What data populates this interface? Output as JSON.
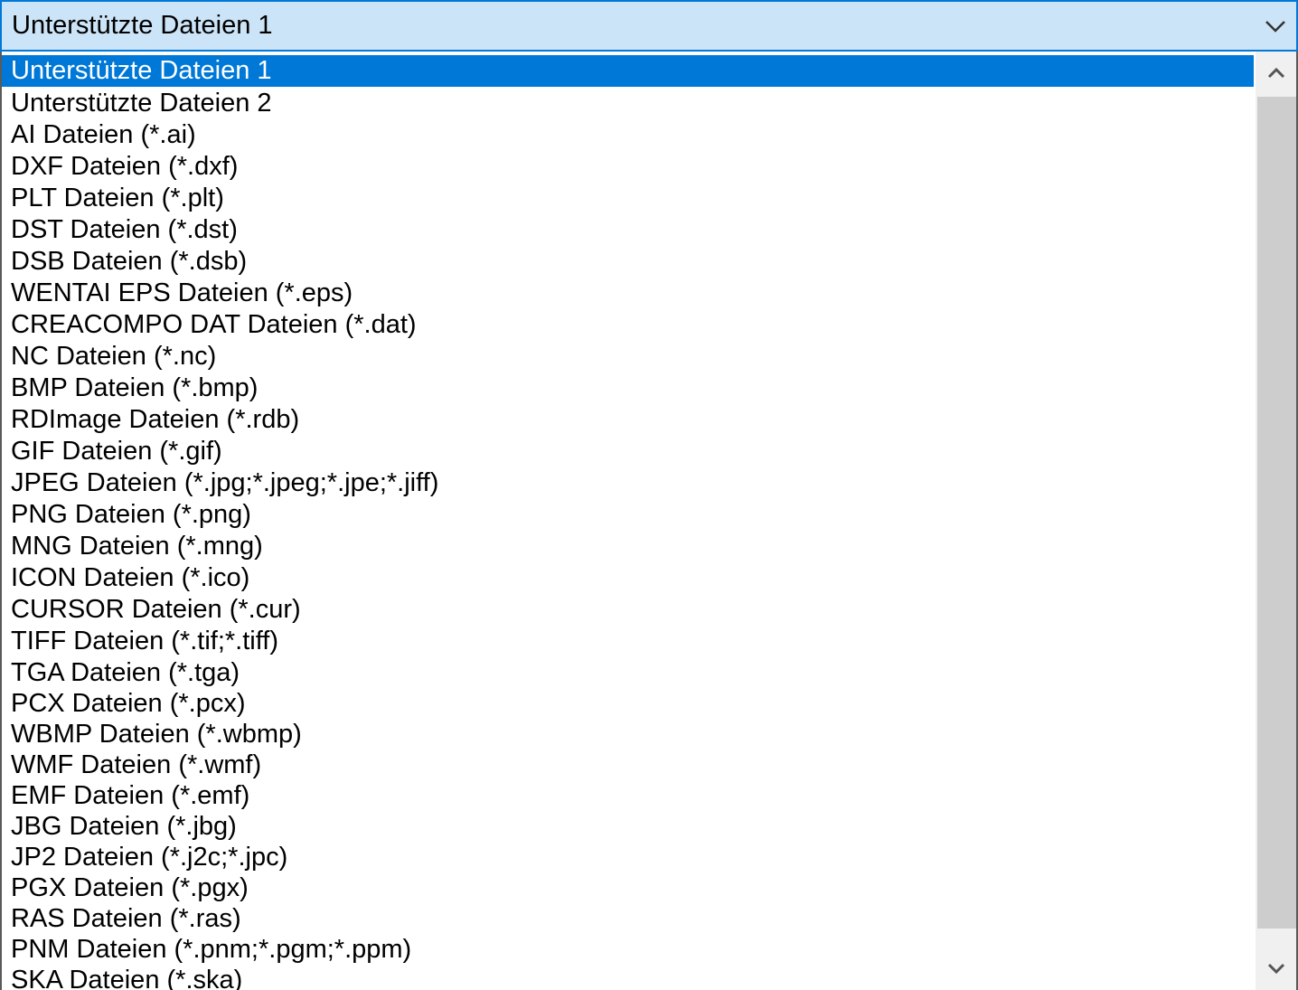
{
  "combobox": {
    "selected_value": "Unterstützte Dateien 1",
    "arrow_icon": "chevron-down-icon"
  },
  "list": {
    "selected_index": 0,
    "items": [
      "Unterstützte Dateien 1",
      "Unterstützte Dateien 2",
      "AI Dateien (*.ai)",
      "DXF Dateien (*.dxf)",
      "PLT Dateien (*.plt)",
      "DST Dateien (*.dst)",
      "DSB Dateien (*.dsb)",
      "WENTAI EPS Dateien (*.eps)",
      "CREACOMPO DAT Dateien (*.dat)",
      "NC Dateien (*.nc)",
      "BMP Dateien (*.bmp)",
      "RDImage Dateien (*.rdb)",
      "GIF Dateien (*.gif)",
      "JPEG Dateien (*.jpg;*.jpeg;*.jpe;*.jiff)",
      "PNG Dateien (*.png)",
      "MNG Dateien (*.mng)",
      "ICON Dateien (*.ico)",
      "CURSOR Dateien (*.cur)",
      "TIFF Dateien (*.tif;*.tiff)",
      "TGA Dateien (*.tga)",
      "PCX Dateien (*.pcx)",
      "WBMP Dateien (*.wbmp)",
      "WMF Dateien (*.wmf)",
      "EMF Dateien (*.emf)",
      "JBG Dateien (*.jbg)",
      "JP2 Dateien (*.j2c;*.jpc)",
      "PGX Dateien (*.pgx)",
      "RAS Dateien (*.ras)",
      "PNM Dateien (*.pnm;*.pgm;*.ppm)",
      "SKA Dateien (*.ska)"
    ]
  },
  "scrollbar": {
    "up_icon": "chevron-up-icon",
    "down_icon": "chevron-down-icon",
    "position": 0
  },
  "colors": {
    "combo_background": "#cce4f7",
    "combo_border": "#0078d7",
    "selection": "#0078d7",
    "selection_text": "#ffffff",
    "scrollbar_track": "#f0f0f0",
    "scrollbar_thumb": "#cdcdcd"
  }
}
